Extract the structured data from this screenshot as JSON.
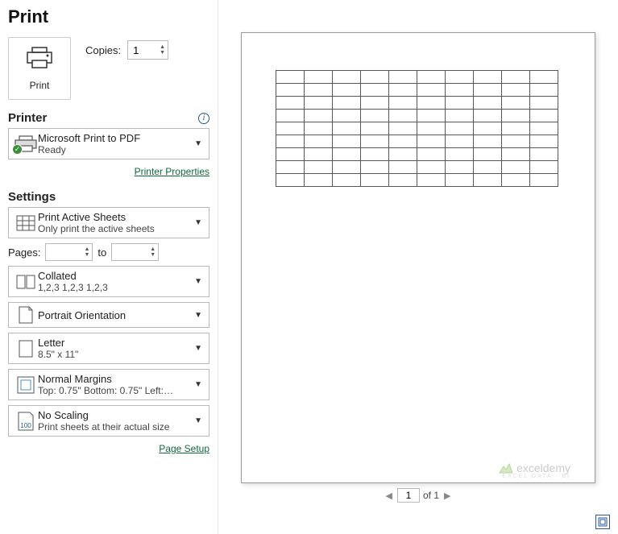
{
  "title": "Print",
  "print_button_label": "Print",
  "copies_label": "Copies:",
  "copies_value": "1",
  "printer_section": "Printer",
  "printer": {
    "name": "Microsoft Print to PDF",
    "status": "Ready"
  },
  "printer_properties_link": "Printer Properties",
  "settings_section": "Settings",
  "active_sheets": {
    "title": "Print Active Sheets",
    "sub": "Only print the active sheets"
  },
  "pages_label": "Pages:",
  "pages_to": "to",
  "pages_from_value": "",
  "pages_to_value": "",
  "collated": {
    "title": "Collated",
    "sub": "1,2,3    1,2,3    1,2,3"
  },
  "orientation": {
    "title": "Portrait Orientation"
  },
  "paper": {
    "title": "Letter",
    "sub": "8.5\" x 11\""
  },
  "margins": {
    "title": "Normal Margins",
    "sub": "Top: 0.75\" Bottom: 0.75\" Left:…"
  },
  "scaling": {
    "title": "No Scaling",
    "sub": "Print sheets at their actual size"
  },
  "page_setup_link": "Page Setup",
  "pager": {
    "current": "1",
    "of_label": "of 1"
  },
  "watermark": "exceldemy",
  "watermark_sub": "EXCEL DATA · BI",
  "preview_grid": {
    "rows": 9,
    "cols": 10
  }
}
